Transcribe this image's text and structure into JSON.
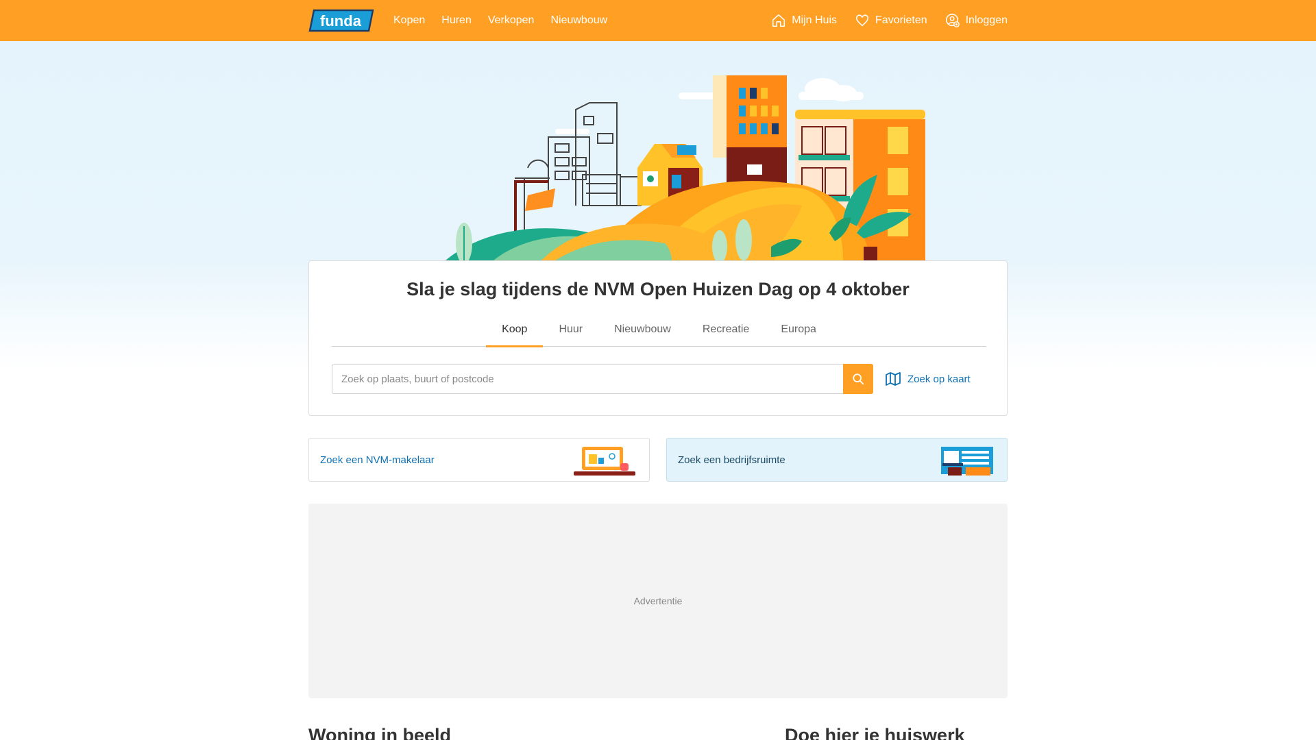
{
  "header": {
    "logo_text": "funda",
    "nav": [
      {
        "label": "Kopen"
      },
      {
        "label": "Huren"
      },
      {
        "label": "Verkopen"
      },
      {
        "label": "Nieuwbouw"
      }
    ],
    "mijn_huis": "Mijn Huis",
    "favorieten": "Favorieten",
    "inloggen": "Inloggen"
  },
  "search": {
    "title": "Sla je slag tijdens de NVM Open Huizen Dag op 4 oktober",
    "tabs": [
      {
        "label": "Koop",
        "active": true
      },
      {
        "label": "Huur"
      },
      {
        "label": "Nieuwbouw"
      },
      {
        "label": "Recreatie"
      },
      {
        "label": "Europa"
      }
    ],
    "placeholder": "Zoek op plaats, buurt of postcode",
    "value": "",
    "map_link": "Zoek op kaart"
  },
  "promos": {
    "makelaar": "Zoek een NVM-makelaar",
    "bedrijfsruimte": "Zoek een bedrijfsruimte"
  },
  "ad": {
    "label": "Advertentie"
  },
  "sections": {
    "woning": "Woning in beeld",
    "huiswerk": "Doe hier je huiswerk"
  },
  "colors": {
    "brand_orange": "#ff9f24",
    "link_blue": "#0e71b3"
  },
  "icons": {
    "search": "search-icon",
    "map": "map-icon",
    "home": "home-icon",
    "heart": "heart-icon",
    "user": "user-icon"
  }
}
